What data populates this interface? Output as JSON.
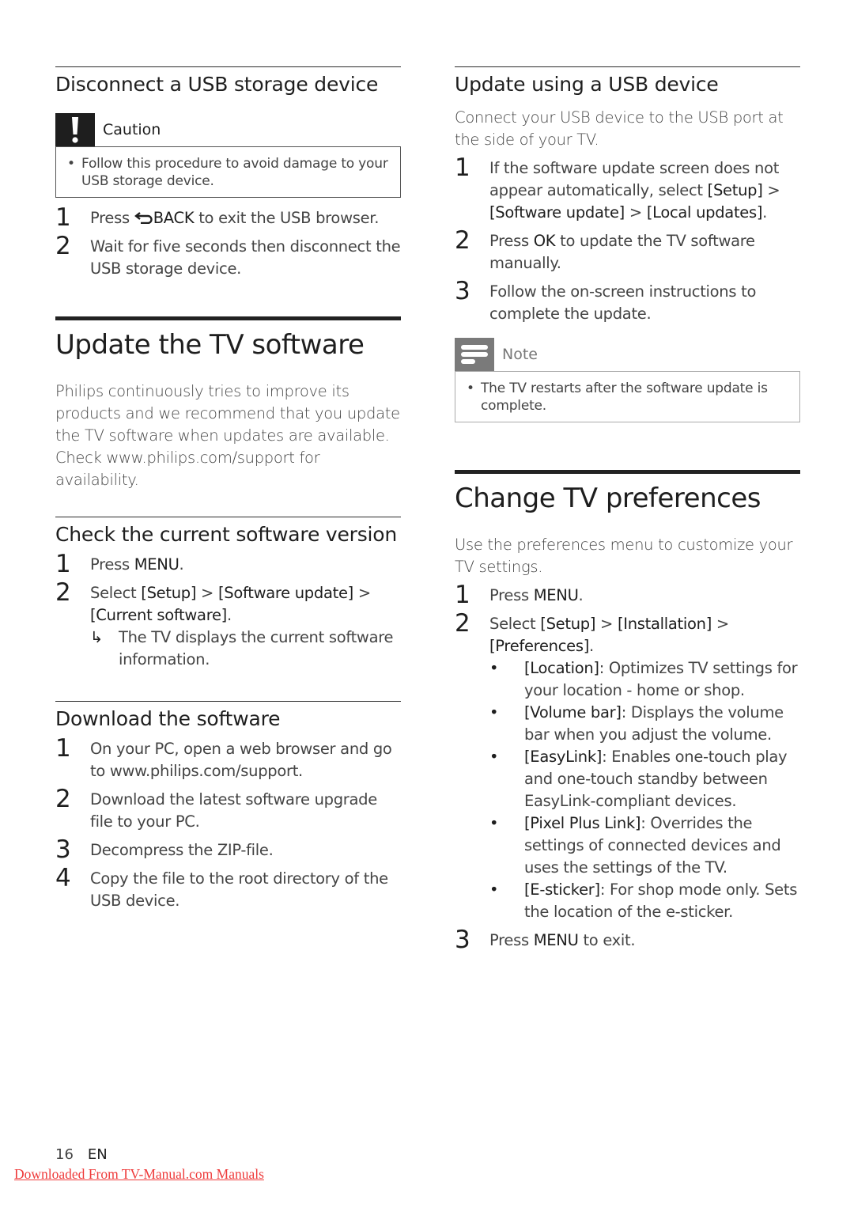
{
  "left": {
    "disconnect": {
      "heading": "Disconnect a USB storage device",
      "caution": {
        "icon": "exclamation-icon",
        "label": "Caution",
        "bullets": [
          "Follow this procedure to avoid damage to your USB storage device."
        ]
      },
      "steps": [
        {
          "num": "1",
          "pre": "Press ",
          "icon": "back-arrow-icon",
          "key": "BACK",
          "post": " to exit the USB browser."
        },
        {
          "num": "2",
          "text": "Wait for five seconds then disconnect the USB storage device."
        }
      ]
    },
    "update": {
      "heading": "Update the TV software",
      "intro": "Philips continuously tries to improve its products and we recommend that you update the TV software when updates are available. Check www.philips.com/support for availability."
    },
    "check": {
      "heading": "Check the current software version",
      "steps": [
        {
          "num": "1",
          "pre": "Press ",
          "key": "MENU",
          "post": "."
        },
        {
          "num": "2",
          "pre": "Select ",
          "k1": "[Setup]",
          "sep1": " > ",
          "k2": "[Software update]",
          "sep2": " > ",
          "k3": "[Current software]",
          "post": ".",
          "result_icon": "result-arrow-icon",
          "result": "The TV displays the current software information."
        }
      ]
    },
    "download": {
      "heading": "Download the software",
      "steps": [
        {
          "num": "1",
          "text": "On your PC, open a web browser and go to www.philips.com/support."
        },
        {
          "num": "2",
          "text": "Download the latest software upgrade file to your PC."
        },
        {
          "num": "3",
          "text": "Decompress the ZIP-file."
        },
        {
          "num": "4",
          "text": "Copy the file to the root directory of the USB device."
        }
      ]
    }
  },
  "right": {
    "usb_update": {
      "heading": "Update using a USB device",
      "intro": "Connect your USB device to the USB port at the side of your TV.",
      "steps": [
        {
          "num": "1",
          "pre": "If the software update screen does not appear automatically, select ",
          "k1": "[Setup]",
          "sep1": " > ",
          "k2": "[Software update]",
          "sep2": " > ",
          "k3": "[Local updates]",
          "post": "."
        },
        {
          "num": "2",
          "pre": "Press ",
          "key": "OK",
          "post": " to update the TV software manually."
        },
        {
          "num": "3",
          "text": "Follow the on-screen instructions to complete the update."
        }
      ],
      "note": {
        "icon": "note-lines-icon",
        "label": "Note",
        "bullets": [
          "The TV restarts after the software update is complete."
        ]
      }
    },
    "preferences": {
      "heading": "Change TV preferences",
      "intro": "Use the preferences menu to customize your TV settings.",
      "steps": [
        {
          "num": "1",
          "pre": "Press ",
          "key": "MENU",
          "post": "."
        },
        {
          "num": "2",
          "pre": "Select ",
          "k1": "[Setup]",
          "sep1": " > ",
          "k2": "[Installation]",
          "sep2": " > ",
          "k3": "[Preferences]",
          "post": "."
        },
        {
          "num": "3",
          "pre": "Press ",
          "key": "MENU",
          "post": " to exit."
        }
      ],
      "options": [
        {
          "key": "[Location]",
          "desc": ": Optimizes TV settings for your location - home or shop."
        },
        {
          "key": "[Volume bar]",
          "desc": ": Displays the volume bar when you adjust the volume."
        },
        {
          "key": "[EasyLink]",
          "desc": ": Enables one-touch play and one-touch standby between EasyLink-compliant devices."
        },
        {
          "key": "[Pixel Plus Link]",
          "desc": ": Overrides the settings of connected devices and uses the settings of the TV."
        },
        {
          "key": "[E-sticker]",
          "desc": ": For shop mode only. Sets the location of the e-sticker."
        }
      ]
    }
  },
  "footer": {
    "page_number": "16",
    "language": "EN",
    "watermark": "Downloaded From TV-Manual.com Manuals"
  },
  "colors": {
    "text": "#444444",
    "heading": "#1e1e1e",
    "caution_bg": "#1e1e1e",
    "note_bg": "#7a7a7a",
    "note_label": "#777777",
    "watermark": "#ee3a3a"
  }
}
